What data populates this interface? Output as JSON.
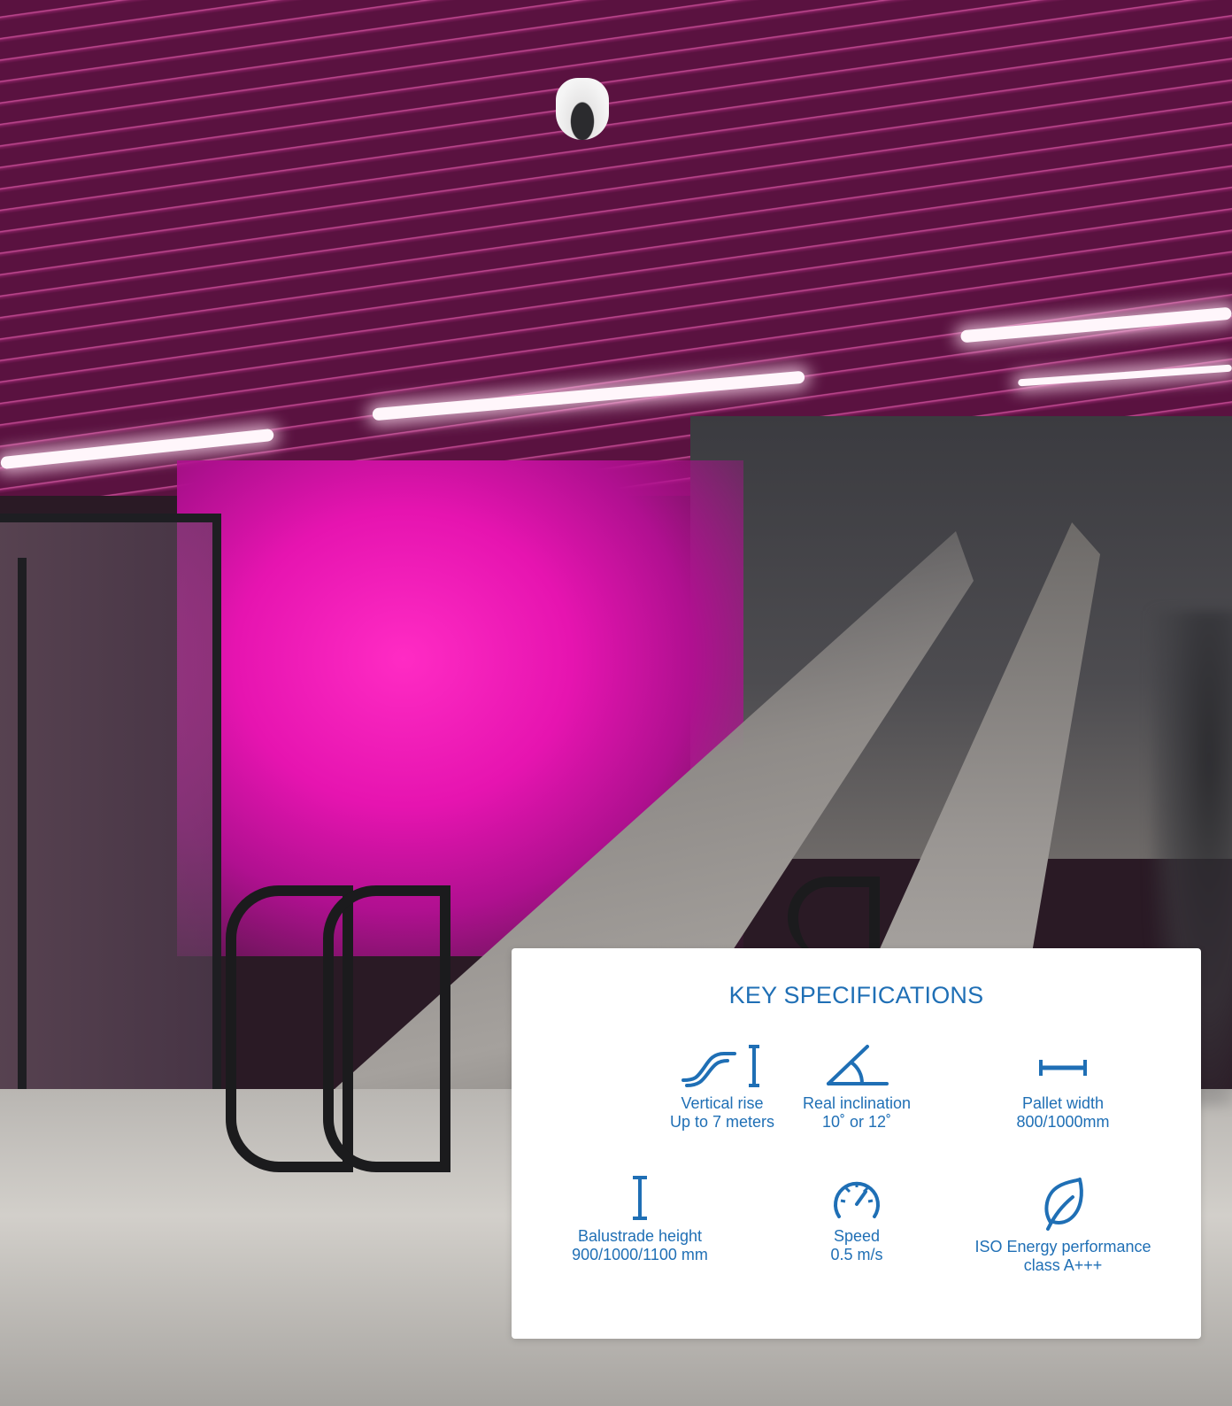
{
  "specs_card": {
    "title": "KEY SPECIFICATIONS",
    "accent_color": "#1f6fb5",
    "items": [
      {
        "icon": "stairs-rise-icon",
        "label": "Vertical rise",
        "value": "Up to 7 meters"
      },
      {
        "icon": "angle-icon",
        "label": "Real inclination",
        "value": "10˚ or 12˚"
      },
      {
        "icon": "width-icon",
        "label": "Pallet width",
        "value": "800/1000mm"
      },
      {
        "icon": "height-icon",
        "label": "Balustrade height",
        "value": "900/1000/1100 mm"
      },
      {
        "icon": "speedometer-icon",
        "label": "Speed",
        "value": "0.5 m/s"
      },
      {
        "icon": "leaf-icon",
        "label": "ISO Energy performance",
        "value": "class A+++"
      }
    ]
  }
}
